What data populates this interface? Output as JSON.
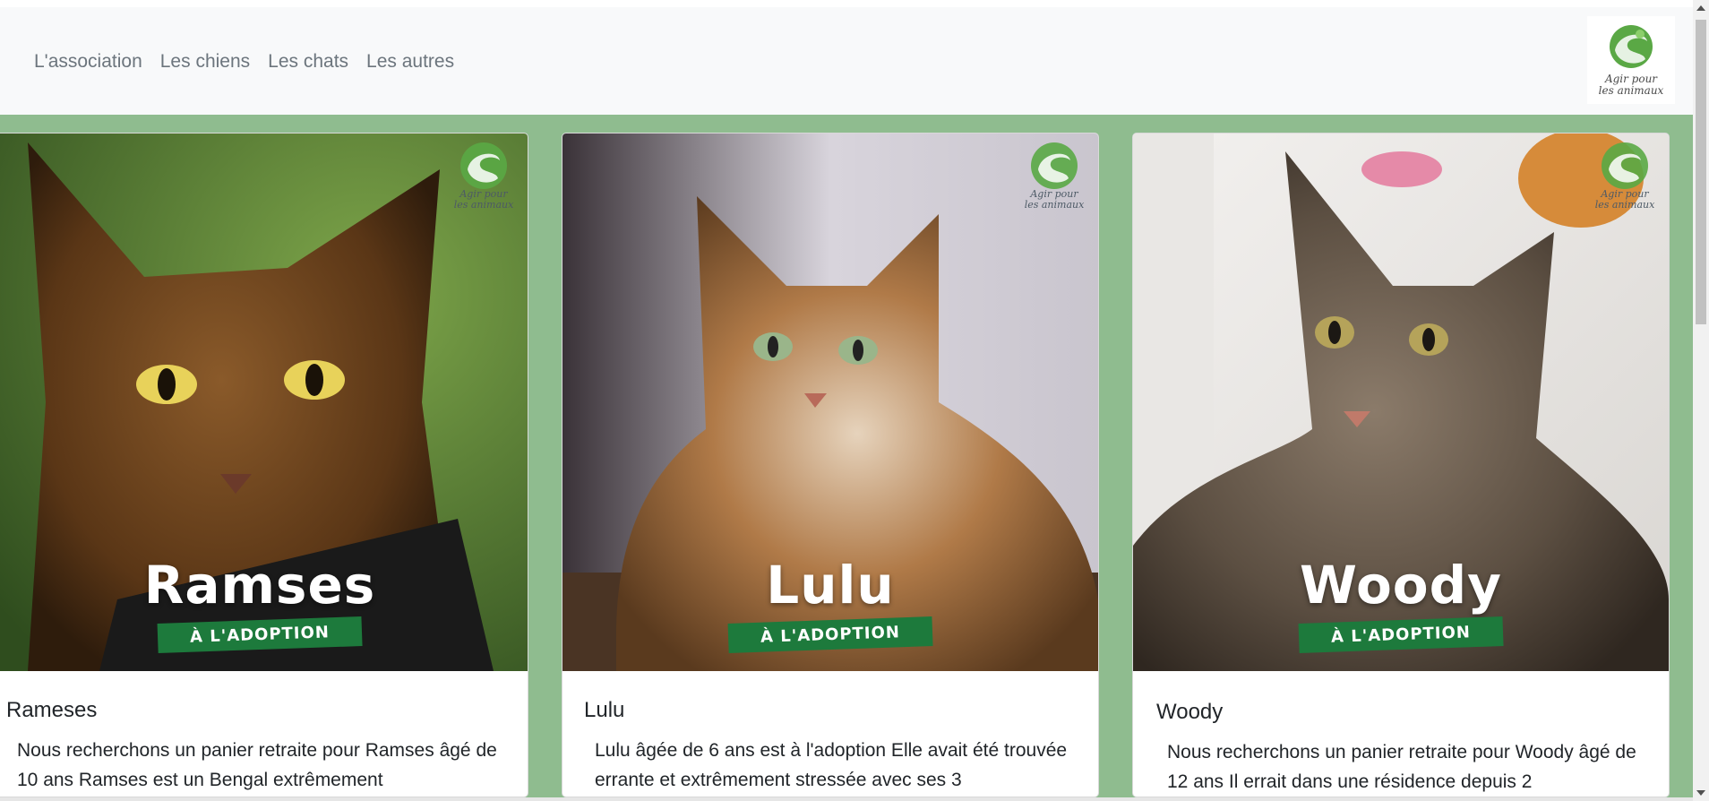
{
  "nav": {
    "links": [
      "L'association",
      "Les chiens",
      "Les chats",
      "Les autres"
    ],
    "brand_line1": "Agir pour",
    "brand_line2": "les animaux"
  },
  "colors": {
    "navbar_bg": "#f8f9fa",
    "content_bg": "#8fbc8f",
    "badge_green": "#1d7a3c",
    "logo_green": "#5aa845"
  },
  "cards": [
    {
      "image_name": "Ramses",
      "image_badge": "À L'ADOPTION",
      "title": "Rameses",
      "text": "Nous recherchons un panier retraite pour Ramses âgé de 10 ans Ramses est un Bengal extrêmement"
    },
    {
      "image_name": "Lulu",
      "image_badge": "À L'ADOPTION",
      "title": "Lulu",
      "text": "Lulu âgée de 6 ans est à l'adoption Elle avait été trouvée errante et extrêmement stressée avec ses 3"
    },
    {
      "image_name": "Woody",
      "image_badge": "À L'ADOPTION",
      "title": "Woody",
      "text": "Nous recherchons un panier retraite pour Woody âgé de 12 ans Il errait dans une résidence depuis 2"
    }
  ],
  "image_logo": {
    "line1": "Agir pour",
    "line2": "les animaux"
  }
}
